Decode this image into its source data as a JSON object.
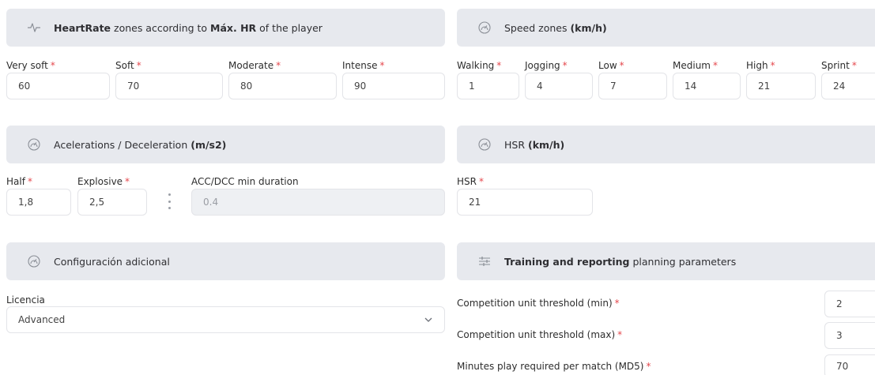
{
  "heart": {
    "title_bold1": "HeartRate",
    "title_mid": " zones according to ",
    "title_bold2": "Máx. HR",
    "title_end": " of the player",
    "icon": "heartbeat-icon",
    "fields": [
      {
        "label": "Very soft",
        "value": "60"
      },
      {
        "label": "Soft",
        "value": "70"
      },
      {
        "label": "Moderate",
        "value": "80"
      },
      {
        "label": "Intense",
        "value": "90"
      }
    ]
  },
  "speed": {
    "title": "Speed zones ",
    "title_bold": "(km/h)",
    "icon": "speedometer-icon",
    "fields": [
      {
        "label": "Walking",
        "value": "1"
      },
      {
        "label": "Jogging",
        "value": "4"
      },
      {
        "label": "Low",
        "value": "7"
      },
      {
        "label": "Medium",
        "value": "14"
      },
      {
        "label": "High",
        "value": "21"
      },
      {
        "label": "Sprint",
        "value": "24"
      }
    ]
  },
  "accel": {
    "title": "Acelerations / Deceleration ",
    "title_bold": "(m/s2)",
    "icon": "speedometer-icon",
    "fields": [
      {
        "label": "Half",
        "value": "1,8"
      },
      {
        "label": "Explosive",
        "value": "2,5"
      }
    ],
    "duration_label": "ACC/DCC min duration",
    "duration_value": "0.4"
  },
  "hsr": {
    "title": "HSR ",
    "title_bold": "(km/h)",
    "icon": "speedometer-icon",
    "label": "HSR",
    "value": "21"
  },
  "config": {
    "title": "Configuración adicional",
    "icon": "speedometer-icon",
    "license_label": "Licencia",
    "license_value": "Advanced"
  },
  "training": {
    "title_bold": "Training and reporting",
    "title_end": " planning parameters",
    "icon": "sliders-icon",
    "rows": [
      {
        "label": "Competition unit threshold (min)",
        "value": "2"
      },
      {
        "label": "Competition unit threshold (max)",
        "value": "3"
      },
      {
        "label": "Minutes play required per match (MD5)",
        "value": "70"
      }
    ]
  },
  "required_mark": "*"
}
